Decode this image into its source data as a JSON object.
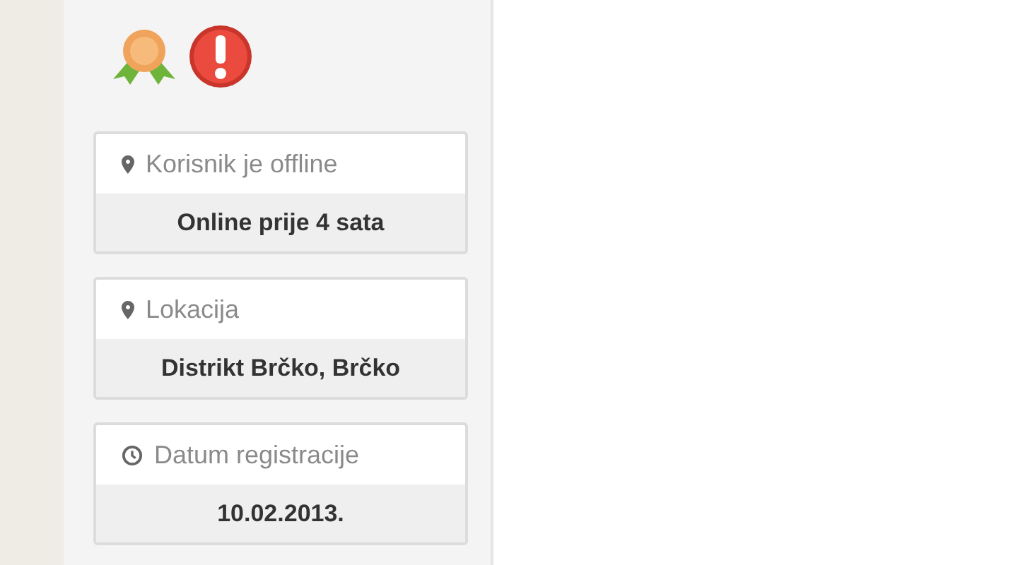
{
  "badges": [
    {
      "kind": "medal"
    },
    {
      "kind": "alert"
    }
  ],
  "info_cards": [
    {
      "kind": "pin",
      "label": "Korisnik je offline",
      "value": "Online prije 4 sata"
    },
    {
      "kind": "pin",
      "label": "Lokacija",
      "value": "Distrikt Brčko, Brčko"
    },
    {
      "kind": "clock",
      "label": "Datum registracije",
      "value": "10.02.2013."
    }
  ]
}
